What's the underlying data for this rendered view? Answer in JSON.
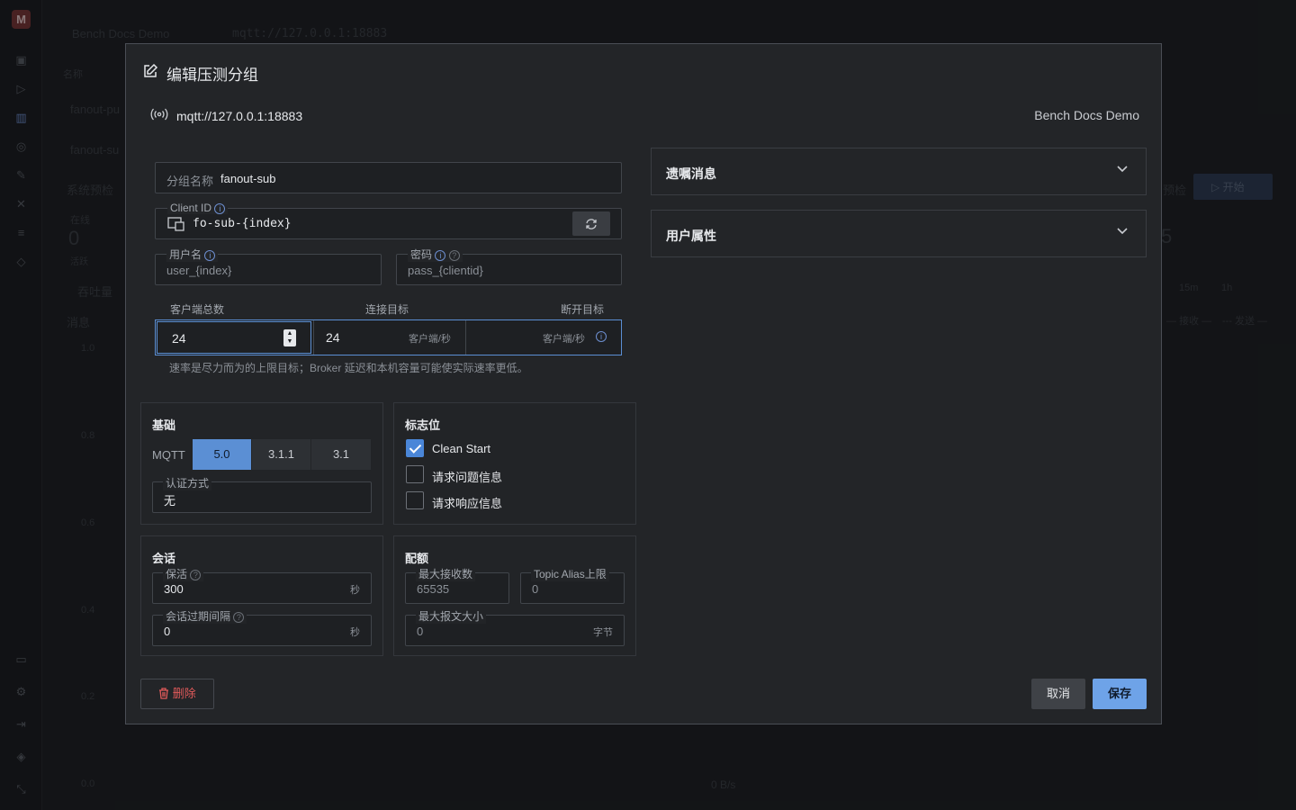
{
  "background": {
    "logo": "M",
    "header_project": "Bench Docs Demo",
    "header_url": "mqtt://127.0.0.1:18883",
    "col_name": "名称",
    "rows": [
      "fanout-pu",
      "fanout-su"
    ],
    "system_check": "系统预检",
    "online_label": "在线",
    "online_value": "0",
    "active_label": "活跃",
    "throughput_tab": "吞吐量",
    "messages_label": "消息",
    "y_ticks": [
      "1.0",
      "0.8",
      "0.6",
      "0.4",
      "0.2",
      "0.0"
    ],
    "rate": "0 B/s",
    "start_button": "开始",
    "check_button": "预检",
    "big_number": "5",
    "range_15m": "15m",
    "range_1h": "1h",
    "legend_recv": "接收",
    "legend_send": "发送"
  },
  "modal": {
    "title": "编辑压测分组",
    "broker_url": "mqtt://127.0.0.1:18883",
    "project_name": "Bench Docs Demo",
    "group_name": {
      "label": "分组名称",
      "value": "fanout-sub"
    },
    "client_id": {
      "label": "Client ID",
      "value": "fo-sub-{index}"
    },
    "username": {
      "label": "用户名",
      "placeholder": "user_{index}"
    },
    "password": {
      "label": "密码",
      "placeholder": "pass_{clientid}"
    },
    "client_total": {
      "label": "客户端总数",
      "value": "24"
    },
    "connect_target": {
      "label": "连接目标",
      "value": "24",
      "unit": "客户端/秒"
    },
    "disconnect_target": {
      "label": "断开目标",
      "unit": "客户端/秒"
    },
    "rate_hint": "速率是尽力而为的上限目标；Broker 延迟和本机容量可能使实际速率更低。",
    "basic": {
      "title": "基础",
      "mqtt_label": "MQTT",
      "versions": [
        "5.0",
        "3.1.1",
        "3.1"
      ],
      "selected_version": "5.0",
      "auth_label": "认证方式",
      "auth_value": "无"
    },
    "flags": {
      "title": "标志位",
      "items": [
        {
          "label": "Clean Start",
          "checked": true
        },
        {
          "label": "请求问题信息",
          "checked": false
        },
        {
          "label": "请求响应信息",
          "checked": false
        }
      ]
    },
    "session": {
      "title": "会话",
      "keepalive_label": "保活",
      "keepalive_value": "300",
      "keepalive_unit": "秒",
      "expiry_label": "会话过期间隔",
      "expiry_value": "0",
      "expiry_unit": "秒"
    },
    "quota": {
      "title": "配额",
      "max_receive_label": "最大接收数",
      "max_receive_placeholder": "65535",
      "topic_alias_label": "Topic Alias上限",
      "topic_alias_placeholder": "0",
      "max_packet_label": "最大报文大小",
      "max_packet_placeholder": "0",
      "max_packet_unit": "字节"
    },
    "will": {
      "title": "遗嘱消息"
    },
    "user_props": {
      "title": "用户属性"
    },
    "delete_button": "删除",
    "cancel_button": "取消",
    "save_button": "保存"
  },
  "colors": {
    "accent": "#5b8fd4",
    "danger": "#e05a5a",
    "surface": "#232528"
  }
}
